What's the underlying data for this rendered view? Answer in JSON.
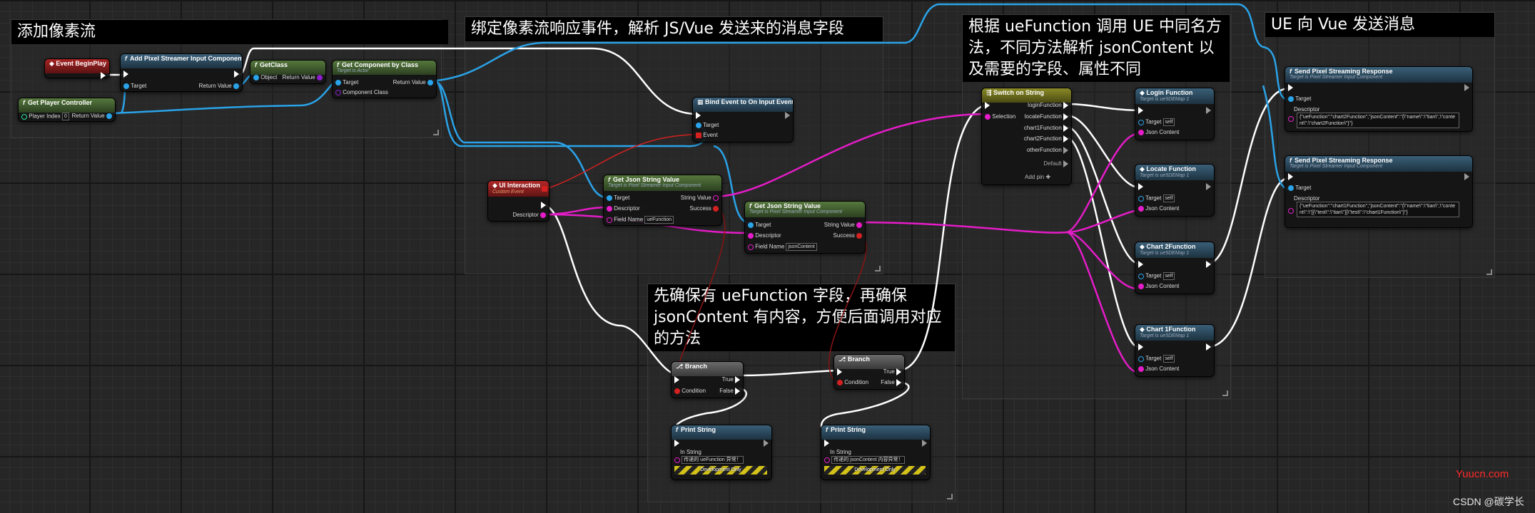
{
  "comments": {
    "c1": "添加像素流",
    "c2": "绑定像素流响应事件，解析 JS/Vue 发送来的消息字段",
    "c3_1": "根据 ueFunction 调用 UE 中同名方",
    "c3_2": "法，不同方法解析 jsonContent 以",
    "c3_3": "及需要的字段、属性不同",
    "c4": "UE 向 Vue 发送消息",
    "c5_1": "先确保有 ueFunction 字段，再确保",
    "c5_2": "jsonContent 有内容，方便后面调用对应",
    "c5_3": "的方法"
  },
  "nodes": {
    "beginplay": {
      "title": "Event BeginPlay"
    },
    "getpc": {
      "title": "Get Player Controller",
      "player_index_label": "Player Index",
      "player_index_value": "0",
      "return_label": "Return Value"
    },
    "addps": {
      "title": "Add Pixel Streamer Input Component",
      "target": "Target",
      "return": "Return Value"
    },
    "getclass": {
      "title": "GetClass",
      "object": "Object",
      "return": "Return Value"
    },
    "getcomp": {
      "title": "Get Component by Class",
      "subtitle": "Target is Actor",
      "target": "Target",
      "return": "Return Value",
      "component_class": "Component Class"
    },
    "bind": {
      "title": "Bind Event to On Input Event",
      "target": "Target",
      "event": "Event"
    },
    "uiinter": {
      "title": "UI Interaction",
      "subtitle": "Custom Event",
      "descriptor": "Descriptor"
    },
    "getjson1": {
      "title": "Get Json String Value",
      "subtitle": "Target is Pixel Streamer Input Component",
      "target": "Target",
      "string_value": "String Value",
      "descriptor": "Descriptor",
      "success": "Success",
      "field_name": "Field Name",
      "field_value": "ueFunction"
    },
    "getjson2": {
      "title": "Get Json String Value",
      "subtitle": "Target is Pixel Streamer Input Component",
      "target": "Target",
      "string_value": "String Value",
      "descriptor": "Descriptor",
      "success": "Success",
      "field_name": "Field Name",
      "field_value": "jsonContent"
    },
    "branch1": {
      "title": "Branch",
      "cond": "Condition",
      "t": "True",
      "f": "False"
    },
    "branch2": {
      "title": "Branch",
      "cond": "Condition",
      "t": "True",
      "f": "False"
    },
    "print1": {
      "title": "Print String",
      "in": "In String",
      "value": "传递的 ueFunction 异常！",
      "dev": "Development Only"
    },
    "print2": {
      "title": "Print String",
      "in": "In String",
      "value": "传递的 jsonContent 内容异常！",
      "dev": "Development Only"
    },
    "switch": {
      "title": "Switch on String",
      "selection": "Selection",
      "o1": "loginFunction",
      "o2": "locateFunction",
      "o3": "chart1Function",
      "o4": "chart2Function",
      "o5": "otherFunction",
      "def": "Default",
      "addpin": "Add pin"
    },
    "login": {
      "title": "Login Function",
      "subtitle": "Target is ue5DEMap 1",
      "target": "Target",
      "self": "self",
      "json": "Json Content"
    },
    "locate": {
      "title": "Locate Function",
      "subtitle": "Target is ue5DEMap 1",
      "target": "Target",
      "self": "self",
      "json": "Json Content"
    },
    "chart2": {
      "title": "Chart 2Function",
      "subtitle": "Target is ue5DEMap 1",
      "target": "Target",
      "self": "self",
      "json": "Json Content"
    },
    "chart1": {
      "title": "Chart 1Function",
      "subtitle": "Target is ue5DEMap 1",
      "target": "Target",
      "self": "self",
      "json": "Json Content"
    },
    "send1": {
      "title": "Send Pixel Streaming Response",
      "subtitle": "Target is Pixel Streamer Input Component",
      "target": "Target",
      "descriptor": "Descriptor",
      "value": "{\"ueFunction\":\"chart2Function\",\"jsonContent\":\"{\\\"name\\\":\\\"tian\\\",\\\"content\\\":\\\"chart2Function\\\"}\"}"
    },
    "send2": {
      "title": "Send Pixel Streaming Response",
      "subtitle": "Target is Pixel Streamer Input Component",
      "target": "Target",
      "descriptor": "Descriptor",
      "value": "{\"ueFunction\":\"chart1Function\",\"jsonContent\":\"{\\\"name\\\":\\\"tian\\\",\\\"content\\\":\\\"[{\\\"test\\\":\\\"tian\\\"}]\\\"test\\\":\\\"chart1Function\\\"}\"}"
    }
  },
  "watermark": {
    "site": "Yuucn.com",
    "author": "CSDN @碳学长"
  },
  "colors": {
    "exec": "#ffffff",
    "object": "#2aa3e8",
    "string": "#e51cc8",
    "bool": "#d42020",
    "class": "#8a1ec8"
  }
}
